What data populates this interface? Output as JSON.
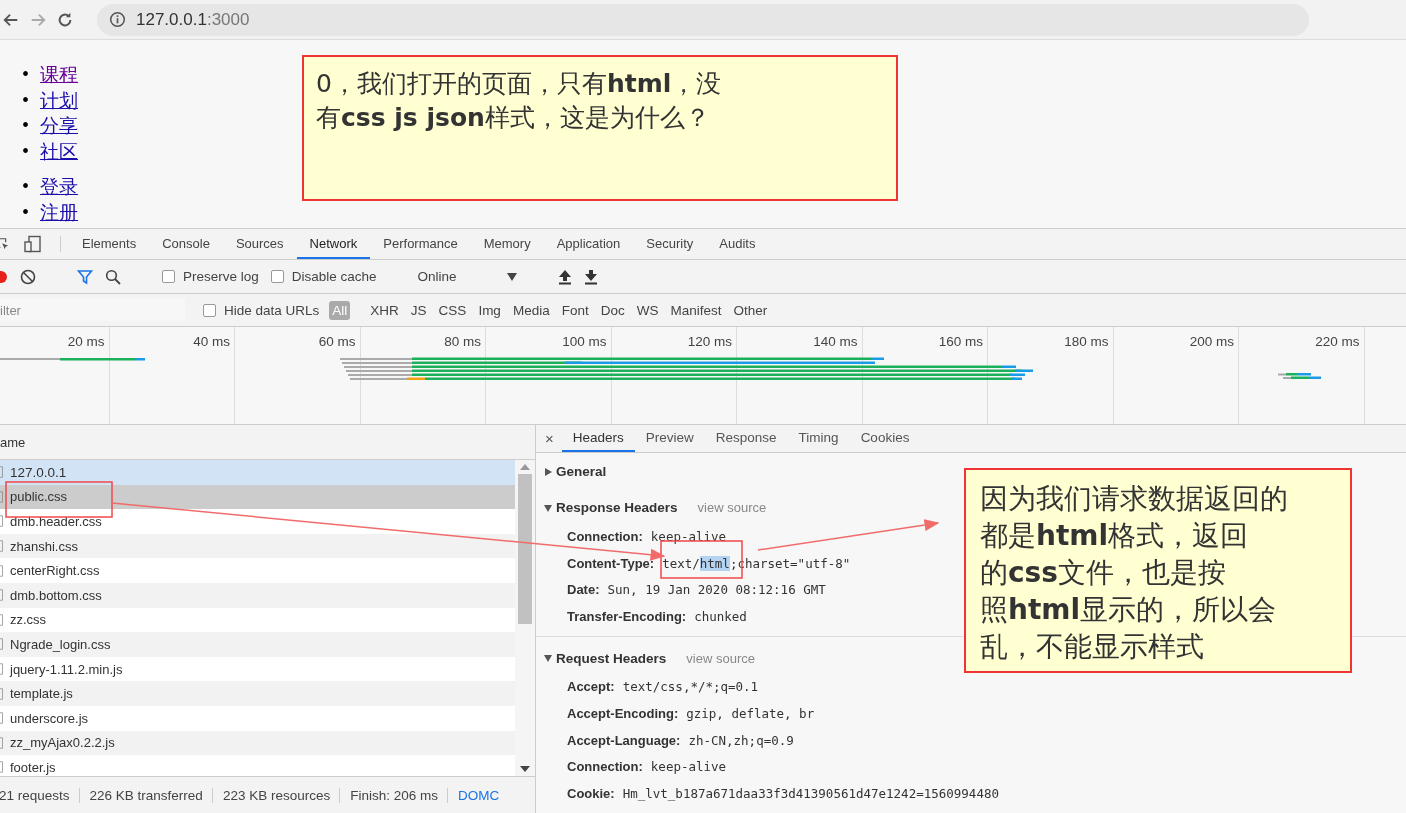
{
  "browser": {
    "url_host": "127.0.0.1",
    "url_port": ":3000"
  },
  "page_lists": [
    [
      {
        "bullet": "•",
        "text": "课程",
        "visited": true
      },
      {
        "bullet": "•",
        "text": "计划",
        "visited": false
      },
      {
        "bullet": "•",
        "text": "分享",
        "visited": false
      },
      {
        "bullet": "•",
        "text": "社区",
        "visited": false
      }
    ],
    [
      {
        "bullet": "•",
        "text": "登录",
        "visited": false
      },
      {
        "bullet": "•",
        "text": "注册",
        "visited": false
      }
    ]
  ],
  "devtools": {
    "panel_tabs": [
      {
        "label": "Elements",
        "selected": false
      },
      {
        "label": "Console",
        "selected": false
      },
      {
        "label": "Sources",
        "selected": false
      },
      {
        "label": "Network",
        "selected": true
      },
      {
        "label": "Performance",
        "selected": false
      },
      {
        "label": "Memory",
        "selected": false
      },
      {
        "label": "Application",
        "selected": false
      },
      {
        "label": "Security",
        "selected": false
      },
      {
        "label": "Audits",
        "selected": false
      }
    ],
    "toolbar": {
      "recording": true,
      "filter_on": true,
      "options": [
        {
          "label": "Preserve log",
          "checked": false
        },
        {
          "label": "Disable cache",
          "checked": false
        }
      ],
      "throttling": "Online"
    },
    "filter": {
      "placeholder": "ilter",
      "hide_data_urls": {
        "label": "Hide data URLs",
        "checked": false
      },
      "types": [
        {
          "label": "All",
          "selected": true
        },
        {
          "label": "XHR",
          "selected": false
        },
        {
          "label": "JS",
          "selected": false
        },
        {
          "label": "CSS",
          "selected": false
        },
        {
          "label": "Img",
          "selected": false
        },
        {
          "label": "Media",
          "selected": false
        },
        {
          "label": "Font",
          "selected": false
        },
        {
          "label": "Doc",
          "selected": false
        },
        {
          "label": "WS",
          "selected": false
        },
        {
          "label": "Manifest",
          "selected": false
        },
        {
          "label": "Other",
          "selected": false
        }
      ]
    },
    "timeline": {
      "ticks": [
        "20 ms",
        "40 ms",
        "60 ms",
        "80 ms",
        "100 ms",
        "120 ms",
        "140 ms",
        "160 ms",
        "180 ms",
        "200 ms",
        "220 ms"
      ]
    },
    "requests": {
      "column": "ame",
      "rows": [
        {
          "name": "127.0.0.1",
          "selected": true,
          "highlighted": false
        },
        {
          "name": "public.css",
          "selected": false,
          "highlighted": true
        },
        {
          "name": "dmb.header.css",
          "selected": false,
          "highlighted": false
        },
        {
          "name": "zhanshi.css",
          "selected": false,
          "highlighted": false
        },
        {
          "name": "centerRight.css",
          "selected": false,
          "highlighted": false
        },
        {
          "name": "dmb.bottom.css",
          "selected": false,
          "highlighted": false
        },
        {
          "name": "zz.css",
          "selected": false,
          "highlighted": false
        },
        {
          "name": "Ngrade_login.css",
          "selected": false,
          "highlighted": false
        },
        {
          "name": "jquery-1.11.2.min.js",
          "selected": false,
          "highlighted": false
        },
        {
          "name": "template.js",
          "selected": false,
          "highlighted": false
        },
        {
          "name": "underscore.js",
          "selected": false,
          "highlighted": false
        },
        {
          "name": "zz_myAjax0.2.2.js",
          "selected": false,
          "highlighted": false
        },
        {
          "name": "footer.js",
          "selected": false,
          "highlighted": false
        }
      ]
    },
    "status_bar": [
      {
        "text": "21 requests",
        "kind": "text"
      },
      {
        "text": "226 KB transferred",
        "kind": "text"
      },
      {
        "text": "223 KB resources",
        "kind": "text"
      },
      {
        "text": "Finish: 206 ms",
        "kind": "text"
      },
      {
        "text": "DOMC",
        "kind": "link"
      }
    ],
    "details": {
      "close": "×",
      "tabs": [
        {
          "label": "Headers",
          "selected": true
        },
        {
          "label": "Preview",
          "selected": false
        },
        {
          "label": "Response",
          "selected": false
        },
        {
          "label": "Timing",
          "selected": false
        },
        {
          "label": "Cookies",
          "selected": false
        }
      ],
      "sections": [
        {
          "title": "General",
          "expanded": false
        },
        {
          "title": "Response Headers",
          "expanded": true,
          "link": "view source",
          "headers": [
            {
              "name": "Connection:",
              "value_parts": [
                {
                  "text": "keep-alive",
                  "highlighted": false
                }
              ]
            },
            {
              "name": "Content-Type:",
              "value_parts": [
                {
                  "text": "text/",
                  "highlighted": false
                },
                {
                  "text": "html",
                  "highlighted": true
                },
                {
                  "text": ";charset=\"utf-8\"",
                  "highlighted": false
                }
              ]
            },
            {
              "name": "Date:",
              "value_parts": [
                {
                  "text": "Sun, 19 Jan 2020 08:12:16 GMT",
                  "highlighted": false
                }
              ]
            },
            {
              "name": "Transfer-Encoding:",
              "value_parts": [
                {
                  "text": "chunked",
                  "highlighted": false
                }
              ]
            }
          ]
        },
        {
          "title": "Request Headers",
          "expanded": true,
          "link": "view source",
          "headers": [
            {
              "name": "Accept:",
              "value_parts": [
                {
                  "text": "text/css,*/*;q=0.1",
                  "highlighted": false
                }
              ]
            },
            {
              "name": "Accept-Encoding:",
              "value_parts": [
                {
                  "text": "gzip, deflate, br",
                  "highlighted": false
                }
              ]
            },
            {
              "name": "Accept-Language:",
              "value_parts": [
                {
                  "text": "zh-CN,zh;q=0.9",
                  "highlighted": false
                }
              ]
            },
            {
              "name": "Connection:",
              "value_parts": [
                {
                  "text": "keep-alive",
                  "highlighted": false
                }
              ]
            },
            {
              "name": "Cookie:",
              "value_parts": [
                {
                  "text": "Hm_lvt_b187a671daa33f3d41390561d47e1242=1560994480",
                  "highlighted": false
                }
              ]
            }
          ]
        }
      ]
    }
  },
  "notes": [
    {
      "lines": [
        "0，我们打开的页面，只有**html**，没",
        "有**css  js json**样式，这是为什么？"
      ]
    },
    {
      "lines": [
        "因为我们请求数据返回的",
        "都是**html**格式，返回",
        "的**css**文件，也是按",
        "照**html**显示的，所以会",
        "乱，不能显示样式"
      ]
    }
  ]
}
